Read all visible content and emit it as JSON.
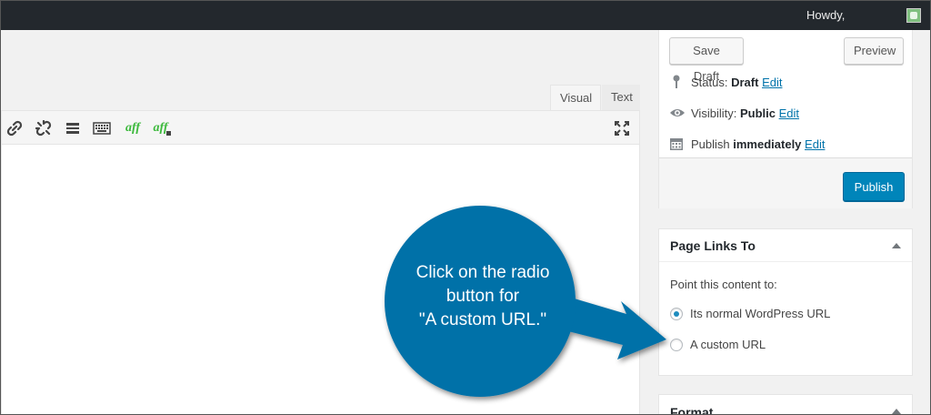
{
  "adminbar": {
    "howdy": "Howdy,"
  },
  "editor": {
    "tabs": {
      "visual": "Visual",
      "text": "Text"
    },
    "toolbar": {
      "aff1": "aff",
      "aff2": "aff"
    }
  },
  "publish": {
    "save_draft": "Save Draft",
    "preview": "Preview",
    "status_label": "Status:",
    "status_value": "Draft",
    "visibility_label": "Visibility:",
    "visibility_value": "Public",
    "publish_label": "Publish",
    "publish_value": "immediately",
    "edit": "Edit",
    "publish_button": "Publish"
  },
  "page_links": {
    "title": "Page Links To",
    "prompt": "Point this content to:",
    "options": [
      {
        "label": "Its normal WordPress URL",
        "checked": true
      },
      {
        "label": "A custom URL",
        "checked": false
      }
    ]
  },
  "format": {
    "title": "Format"
  },
  "callout": {
    "line1": "Click on the radio",
    "line2": "button for",
    "line3": "\"A custom URL.\"",
    "color": "#0071a8"
  },
  "colors": {
    "primary": "#0085ba",
    "link": "#0073aa",
    "adminbar": "#23282d",
    "aff": "#3cb93c"
  }
}
